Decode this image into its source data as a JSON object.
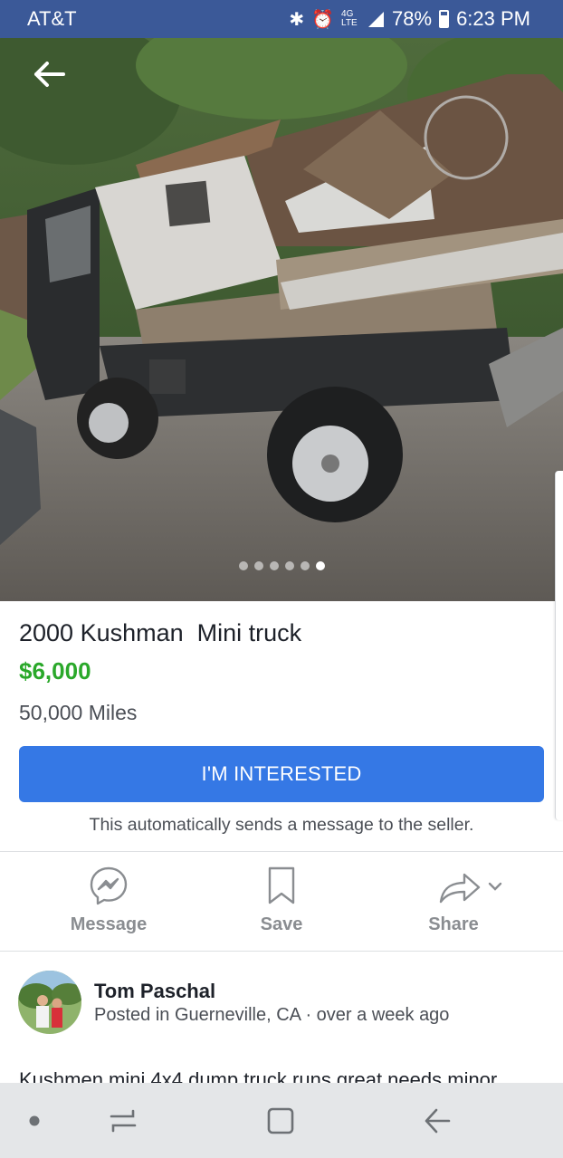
{
  "status_bar": {
    "carrier": "AT&T",
    "network": "4G LTE",
    "battery": "78%",
    "time": "6:23 PM"
  },
  "photo": {
    "image_count": 6,
    "active_index": 5
  },
  "listing": {
    "title": "2000 Kushman  Mini truck",
    "price": "$6,000",
    "mileage": "50,000 Miles",
    "interest_button": "I'M INTERESTED",
    "interest_note": "This automatically sends a message to the seller."
  },
  "actions": {
    "message": "Message",
    "save": "Save",
    "share": "Share"
  },
  "seller": {
    "name": "Tom Paschal",
    "posted": "Posted in Guerneville, CA · over a week ago"
  },
  "description": "Kushmen mini 4x4 dump truck runs great needs minor",
  "colors": {
    "header": "#3b5998",
    "button": "#3578e5",
    "price": "#2aa82a"
  }
}
